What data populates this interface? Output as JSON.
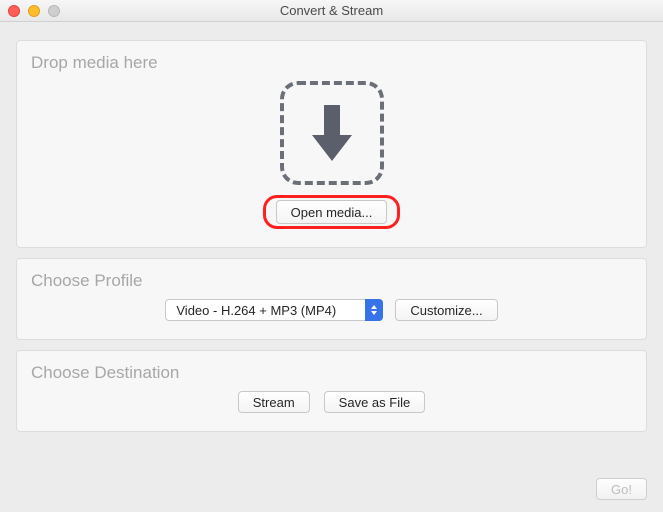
{
  "window": {
    "title": "Convert & Stream"
  },
  "drop": {
    "heading": "Drop media here",
    "open_label": "Open media..."
  },
  "profile": {
    "heading": "Choose Profile",
    "selected": "Video - H.264 + MP3 (MP4)",
    "customize_label": "Customize..."
  },
  "destination": {
    "heading": "Choose Destination",
    "stream_label": "Stream",
    "save_label": "Save as File"
  },
  "footer": {
    "go_label": "Go!"
  }
}
